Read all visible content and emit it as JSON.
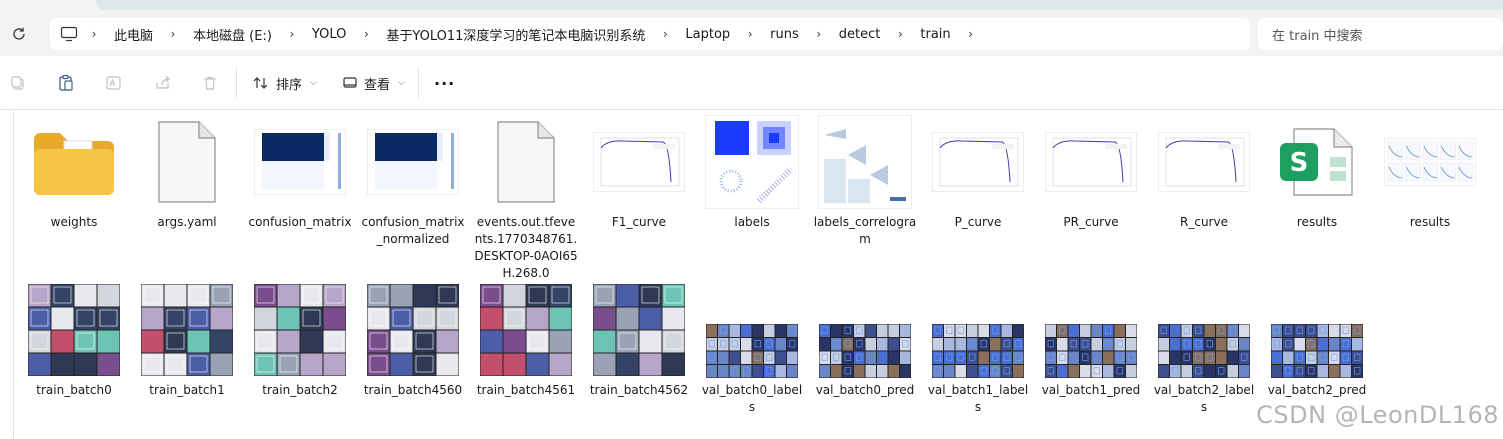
{
  "address": {
    "segments": [
      "此电脑",
      "本地磁盘 (E:)",
      "YOLO",
      "基于YOLO11深度学习的笔记本电脑识别系统",
      "Laptop",
      "runs",
      "detect",
      "train"
    ]
  },
  "search": {
    "placeholder": "在 train 中搜索"
  },
  "toolbar": {
    "sort_label": "排序",
    "view_label": "查看",
    "more_label": "···"
  },
  "files": [
    {
      "name": "weights",
      "type": "folder"
    },
    {
      "name": "args.yaml",
      "type": "file"
    },
    {
      "name": "confusion_matrix",
      "type": "image-cm"
    },
    {
      "name": "confusion_matrix_normalized",
      "type": "image-cm"
    },
    {
      "name": "events.out.tfevents.1770348761.DESKTOP-0AOI65H.268.0",
      "type": "file"
    },
    {
      "name": "F1_curve",
      "type": "image-curve"
    },
    {
      "name": "labels",
      "type": "image-labels"
    },
    {
      "name": "labels_correlogram",
      "type": "image-correlogram"
    },
    {
      "name": "P_curve",
      "type": "image-curve"
    },
    {
      "name": "PR_curve",
      "type": "image-curve"
    },
    {
      "name": "R_curve",
      "type": "image-curve"
    },
    {
      "name": "results",
      "type": "spreadsheet"
    },
    {
      "name": "results",
      "type": "image-results"
    },
    {
      "name": "train_batch0",
      "type": "image-batch"
    },
    {
      "name": "train_batch1",
      "type": "image-batch"
    },
    {
      "name": "train_batch2",
      "type": "image-batch"
    },
    {
      "name": "train_batch4560",
      "type": "image-batch"
    },
    {
      "name": "train_batch4561",
      "type": "image-batch"
    },
    {
      "name": "train_batch4562",
      "type": "image-batch"
    },
    {
      "name": "val_batch0_labels",
      "type": "image-val"
    },
    {
      "name": "val_batch0_pred",
      "type": "image-val"
    },
    {
      "name": "val_batch1_labels",
      "type": "image-val"
    },
    {
      "name": "val_batch1_pred",
      "type": "image-val"
    },
    {
      "name": "val_batch2_labels",
      "type": "image-val"
    },
    {
      "name": "val_batch2_pred",
      "type": "image-val"
    }
  ],
  "watermark": "CSDN @LeonDL168",
  "colors": {
    "folder": "#f7c444",
    "excel": "#1d9f61",
    "cm": "#0b2a63",
    "curve": "#3b3bb0"
  }
}
